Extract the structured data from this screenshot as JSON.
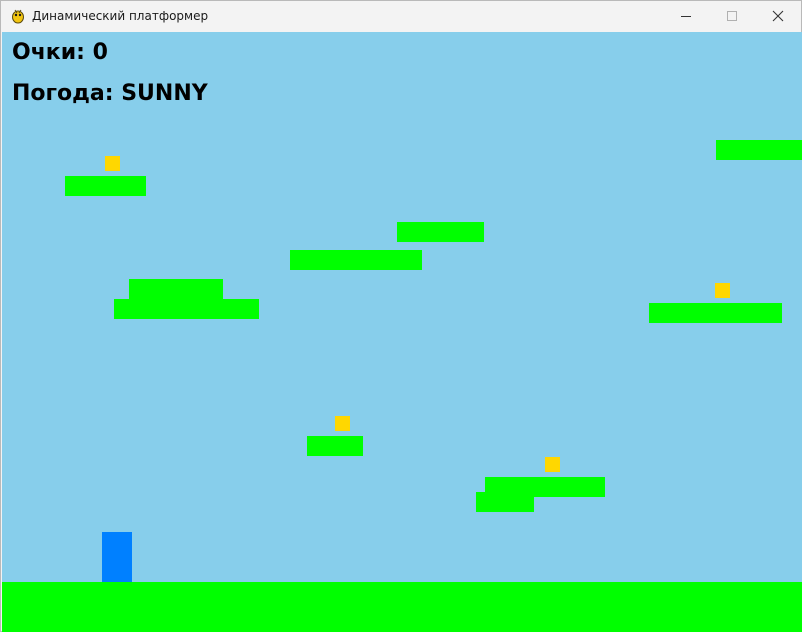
{
  "window": {
    "title": "Динамический платформер",
    "app_icon": "pygame-snake-icon",
    "controls": [
      "minimize-icon",
      "maximize-icon",
      "close-icon"
    ]
  },
  "hud": {
    "score_text": "Очки: 0",
    "weather_text": "Погода: SUNNY"
  },
  "game_state": {
    "score": 0,
    "weather": "SUNNY"
  },
  "colors": {
    "sky": "#87ceeb",
    "platform": "#00ff00",
    "ground": "#00ff00",
    "coin": "#ffd700",
    "player": "#0080ff",
    "hud_text": "#000000"
  }
}
